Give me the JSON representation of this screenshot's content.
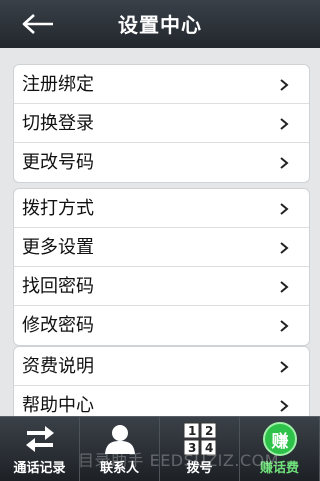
{
  "header": {
    "title": "设置中心",
    "back_icon": "back-arrow-icon"
  },
  "groups": [
    {
      "items": [
        {
          "label": "注册绑定"
        },
        {
          "label": "切换登录"
        },
        {
          "label": "更改号码"
        }
      ]
    },
    {
      "items": [
        {
          "label": "拨打方式"
        },
        {
          "label": "更多设置"
        },
        {
          "label": "找回密码"
        },
        {
          "label": "修改密码"
        }
      ]
    },
    {
      "items": [
        {
          "label": "资费说明"
        },
        {
          "label": "帮助中心"
        }
      ]
    }
  ],
  "tabs": [
    {
      "label": "通话记录",
      "icon": "swap-arrows-icon"
    },
    {
      "label": "联系人",
      "icon": "person-icon"
    },
    {
      "label": "拨号",
      "icon": "keypad-icon"
    },
    {
      "label": "赚话费",
      "icon": "earn-credit-icon",
      "badge": "赚"
    }
  ],
  "watermark": "目录助手 EEDSUZIZ.COM",
  "colors": {
    "header_bg": "#2b3037",
    "active_green": "#2ec24a"
  }
}
